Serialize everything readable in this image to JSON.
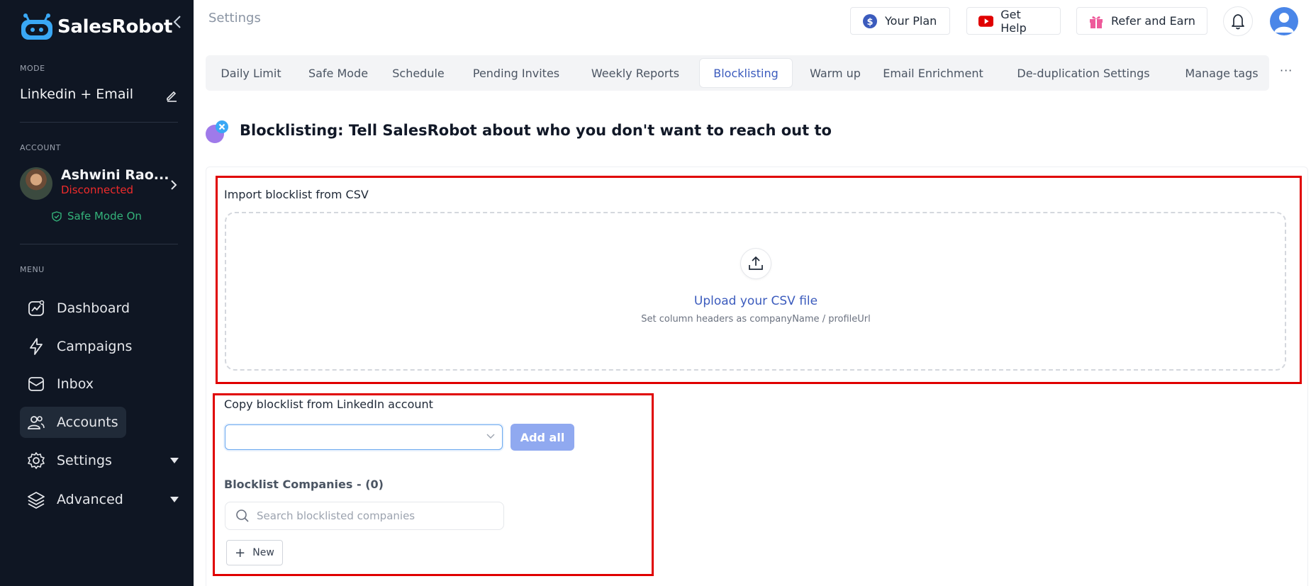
{
  "app": {
    "name": "SalesRobot"
  },
  "sidebar": {
    "mode_label": "MODE",
    "mode_value": "Linkedin + Email",
    "account_label": "ACCOUNT",
    "account": {
      "name": "Ashwini Rao...",
      "status": "Disconnected",
      "safe_mode": "Safe Mode On"
    },
    "menu_label": "MENU",
    "nav": [
      {
        "label": "Dashboard",
        "icon": "dashboard-icon"
      },
      {
        "label": "Campaigns",
        "icon": "lightning-icon"
      },
      {
        "label": "Inbox",
        "icon": "inbox-icon"
      },
      {
        "label": "Accounts",
        "icon": "users-icon",
        "active": true
      },
      {
        "label": "Settings",
        "icon": "gear-icon"
      },
      {
        "label": "Advanced",
        "icon": "layers-icon"
      }
    ]
  },
  "topbar": {
    "page_title": "Settings",
    "your_plan": "Your Plan",
    "get_help": "Get Help",
    "refer": "Refer and Earn"
  },
  "tabs": [
    {
      "label": "Daily Limit"
    },
    {
      "label": "Safe Mode"
    },
    {
      "label": "Schedule"
    },
    {
      "label": "Pending Invites"
    },
    {
      "label": "Weekly Reports"
    },
    {
      "label": "Blocklisting",
      "active": true
    },
    {
      "label": "Warm up"
    },
    {
      "label": "Email Enrichment"
    },
    {
      "label": "De-duplication Settings"
    },
    {
      "label": "Manage tags"
    }
  ],
  "tabs_more": "···",
  "header": {
    "title": "Blocklisting: Tell SalesRobot about who you don't want to reach out to"
  },
  "import": {
    "label": "Import blocklist from CSV",
    "upload_title": "Upload your CSV file",
    "upload_subtitle": "Set column headers as companyName / profileUrl"
  },
  "copy": {
    "label": "Copy blocklist from LinkedIn account",
    "select_value": "",
    "add_all": "Add all",
    "blocklist_heading": "Blocklist Companies - (0)",
    "search_placeholder": "Search blocklisted companies",
    "new_button": "New"
  },
  "colors": {
    "sidebar_bg": "#0f1623",
    "accent_blue": "#3b5bbd",
    "disconnected_red": "#ef2b2b",
    "safe_green": "#34b37a",
    "highlight_red": "#e00000",
    "add_all_bg": "#90a9f0"
  }
}
